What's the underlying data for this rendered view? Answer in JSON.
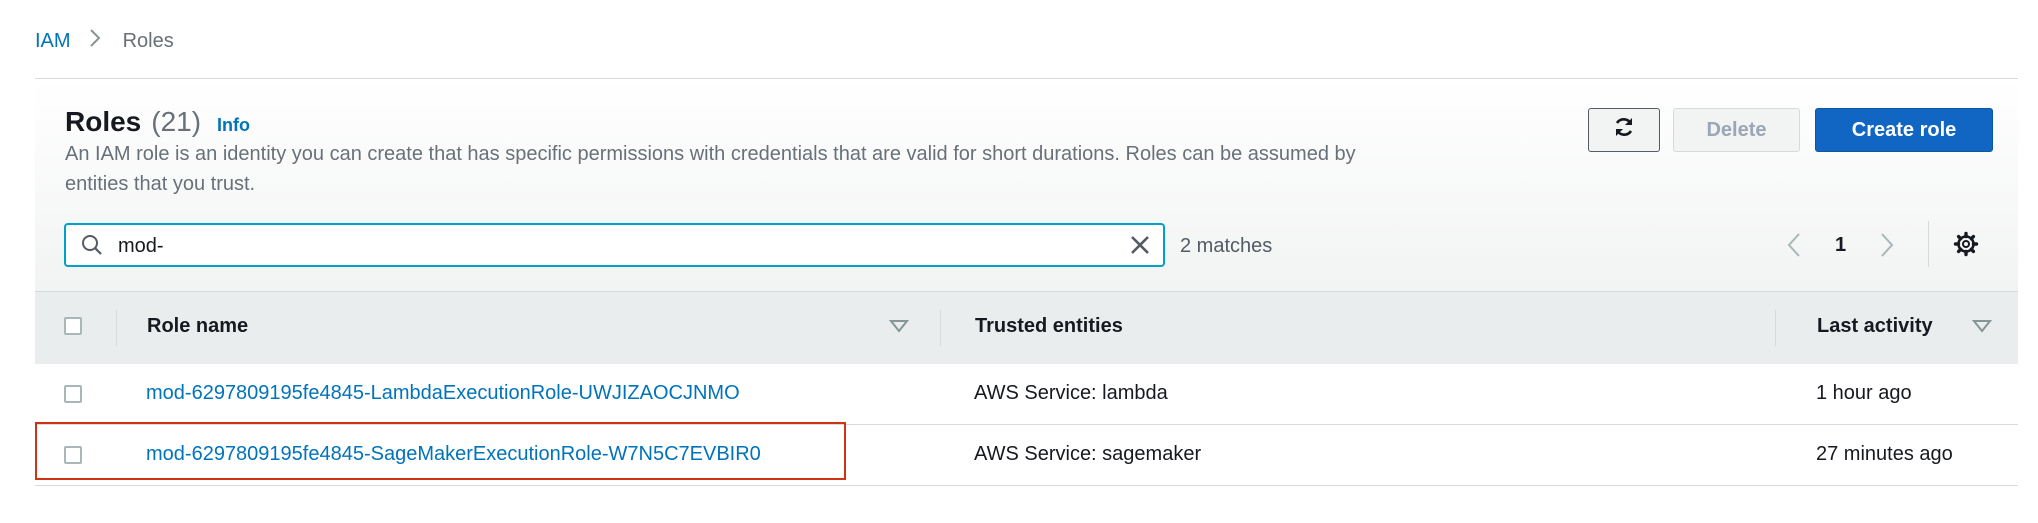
{
  "breadcrumb": {
    "root": "IAM",
    "current": "Roles"
  },
  "header": {
    "title": "Roles",
    "count": "(21)",
    "info": "Info",
    "description": "An IAM role is an identity you can create that has specific permissions with credentials that are valid for short durations. Roles can be assumed by entities that you trust."
  },
  "actions": {
    "delete": "Delete",
    "create": "Create role"
  },
  "search": {
    "value": "mod-",
    "matches": "2 matches"
  },
  "pagination": {
    "page": "1"
  },
  "table": {
    "columns": [
      "Role name",
      "Trusted entities",
      "Last activity"
    ],
    "rows": [
      {
        "role_name": "mod-6297809195fe4845-LambdaExecutionRole-UWJIZAOCJNMO",
        "trusted": "AWS Service: lambda",
        "last_activity": "1 hour ago"
      },
      {
        "role_name": "mod-6297809195fe4845-SageMakerExecutionRole-W7N5C7EVBIR0",
        "trusted": "AWS Service: sagemaker",
        "last_activity": "27 minutes ago"
      }
    ]
  },
  "colors": {
    "link": "#0073bb",
    "primary": "#1066c2",
    "focus": "#00a1c9",
    "highlight": "#d13212"
  },
  "icons": [
    "chevron-right-icon",
    "refresh-icon",
    "search-icon",
    "close-icon",
    "chevron-left-icon",
    "gear-icon",
    "sort-caret-icon"
  ]
}
